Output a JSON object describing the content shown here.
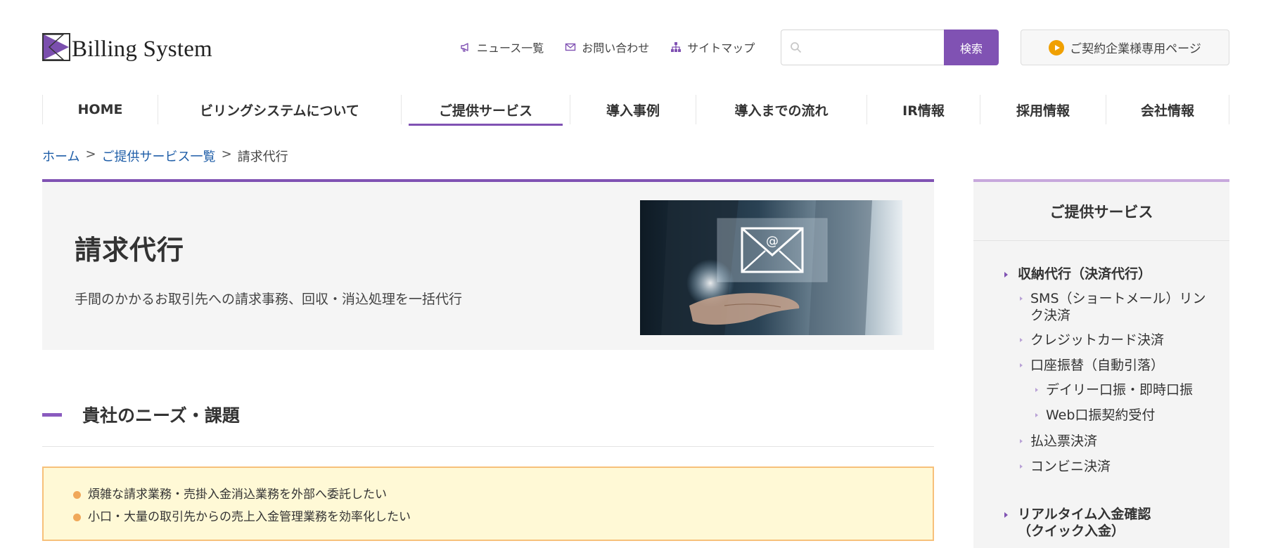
{
  "brand": {
    "name": "Billing System",
    "accent": "#8052b3"
  },
  "utility_links": [
    {
      "icon": "megaphone-icon",
      "label": "ニュース一覧"
    },
    {
      "icon": "mail-icon",
      "label": "お問い合わせ"
    },
    {
      "icon": "sitemap-icon",
      "label": "サイトマップ"
    }
  ],
  "search": {
    "placeholder": "",
    "button_label": "検索"
  },
  "member_page": {
    "label": "ご契約企業様専用ページ"
  },
  "global_nav": [
    {
      "label": "HOME",
      "active": false
    },
    {
      "label": "ビリングシステムについて",
      "active": false
    },
    {
      "label": "ご提供サービス",
      "active": true
    },
    {
      "label": "導入事例",
      "active": false
    },
    {
      "label": "導入までの流れ",
      "active": false
    },
    {
      "label": "IR情報",
      "active": false
    },
    {
      "label": "採用情報",
      "active": false
    },
    {
      "label": "会社情報",
      "active": false
    }
  ],
  "breadcrumb": {
    "home": "ホーム",
    "separator": ">",
    "services": "ご提供サービス一覧",
    "current": "請求代行"
  },
  "hero": {
    "title": "請求代行",
    "description": "手間のかかるお取引先への請求事務、回収・消込処理を一括代行"
  },
  "needs_section": {
    "heading": "貴社のニーズ・課題",
    "items": [
      "煩雑な請求業務・売掛入金消込業務を外部へ委託したい",
      "小口・大量の取引先からの売上入金管理業務を効率化したい"
    ]
  },
  "sidebar": {
    "title": "ご提供サービス",
    "items": [
      {
        "label": "収納代行（決済代行）",
        "level": 1
      },
      {
        "label": "SMS（ショートメール）リンク決済",
        "level": 2
      },
      {
        "label": "クレジットカード決済",
        "level": 2
      },
      {
        "label": "口座振替（自動引落）",
        "level": 2
      },
      {
        "label": "デイリー口振・即時口振",
        "level": 3
      },
      {
        "label": "Web口振契約受付",
        "level": 3
      },
      {
        "label": "払込票決済",
        "level": 2
      },
      {
        "label": "コンビニ決済",
        "level": 2
      },
      {
        "label": "リアルタイム入金確認（クイック入金）",
        "level": 1
      }
    ]
  }
}
